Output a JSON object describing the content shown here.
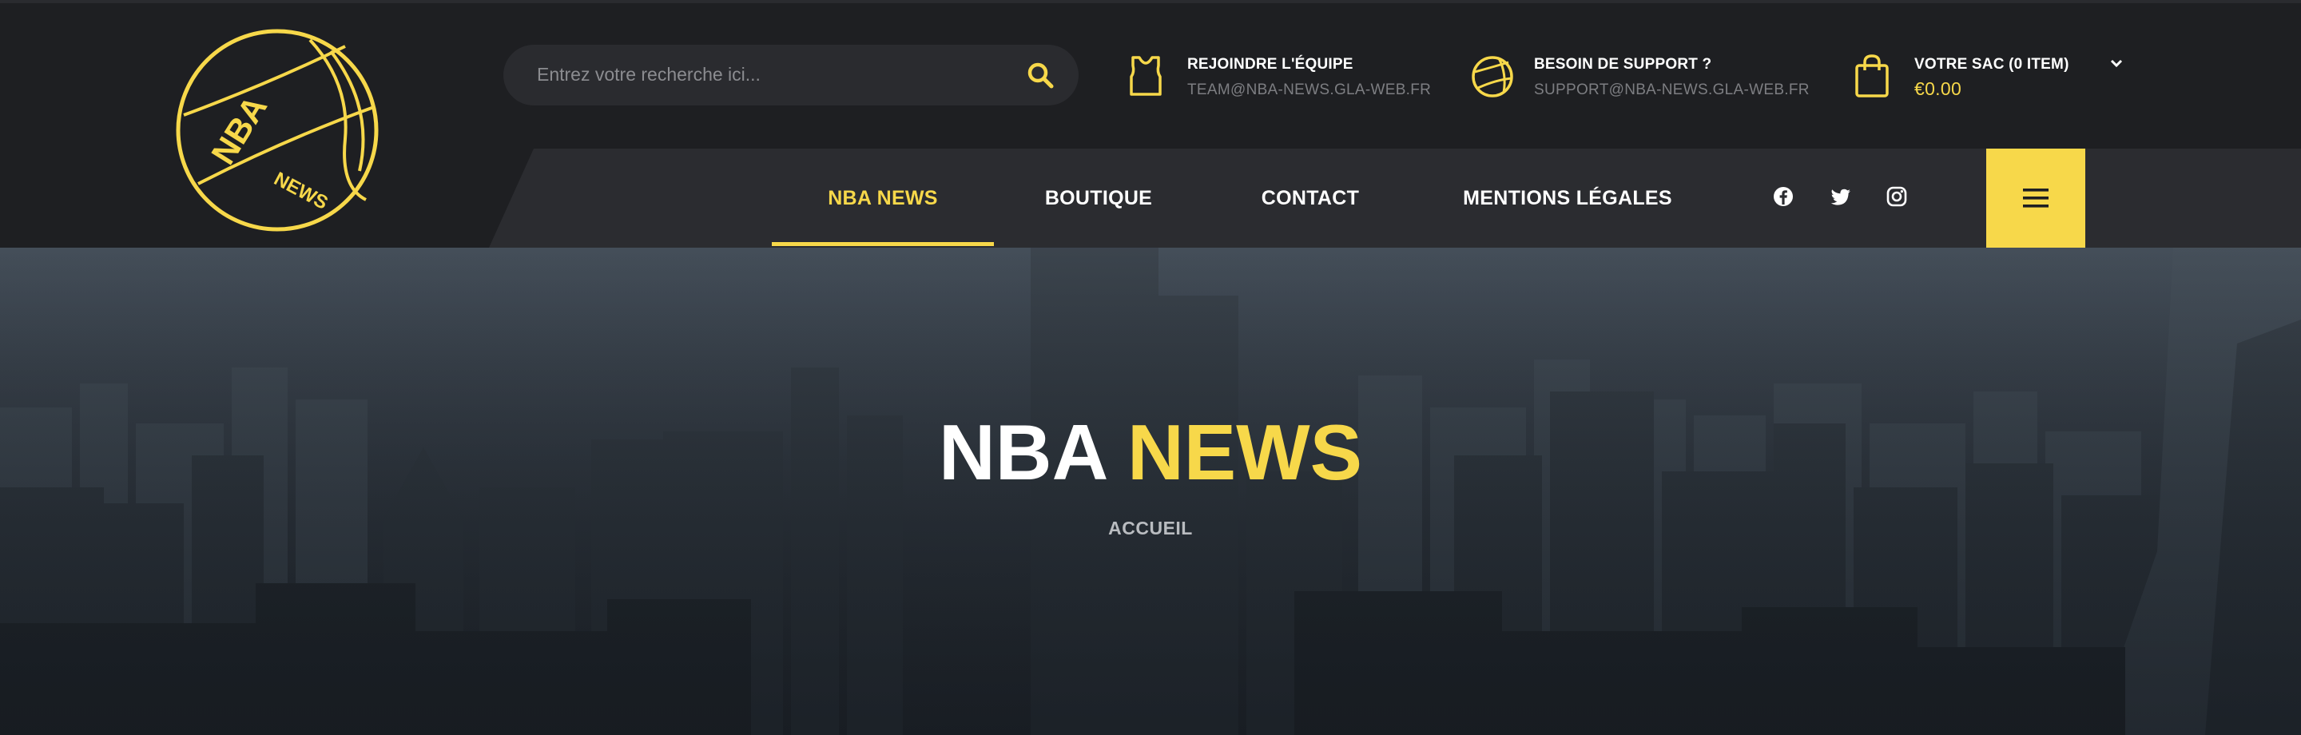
{
  "brand": {
    "logo_text_1": "NBA",
    "logo_text_2": "NEWS",
    "accent_color": "#f7d84a"
  },
  "search": {
    "placeholder": "Entrez votre recherche ici...",
    "icon": "search-icon"
  },
  "contact_blocks": [
    {
      "icon": "jersey-icon",
      "title": "REJOINDRE L'ÉQUIPE",
      "subtitle": "TEAM@NBA-NEWS.GLA-WEB.FR"
    },
    {
      "icon": "basketball-icon",
      "title": "BESOIN DE SUPPORT ?",
      "subtitle": "SUPPORT@NBA-NEWS.GLA-WEB.FR"
    }
  ],
  "cart": {
    "icon": "shopping-bag-icon",
    "title": "VOTRE SAC (0 ITEM)",
    "total": "€0.00"
  },
  "nav": {
    "items": [
      {
        "label": "NBA NEWS",
        "active": true
      },
      {
        "label": "BOUTIQUE",
        "active": false
      },
      {
        "label": "CONTACT",
        "active": false
      },
      {
        "label": "MENTIONS LÉGALES",
        "active": false
      }
    ],
    "social": [
      "facebook-icon",
      "twitter-icon",
      "instagram-icon"
    ],
    "menu_icon": "hamburger-menu-icon"
  },
  "hero": {
    "title_part1": "NBA",
    "title_part2": "NEWS",
    "breadcrumb": "ACCUEIL"
  }
}
